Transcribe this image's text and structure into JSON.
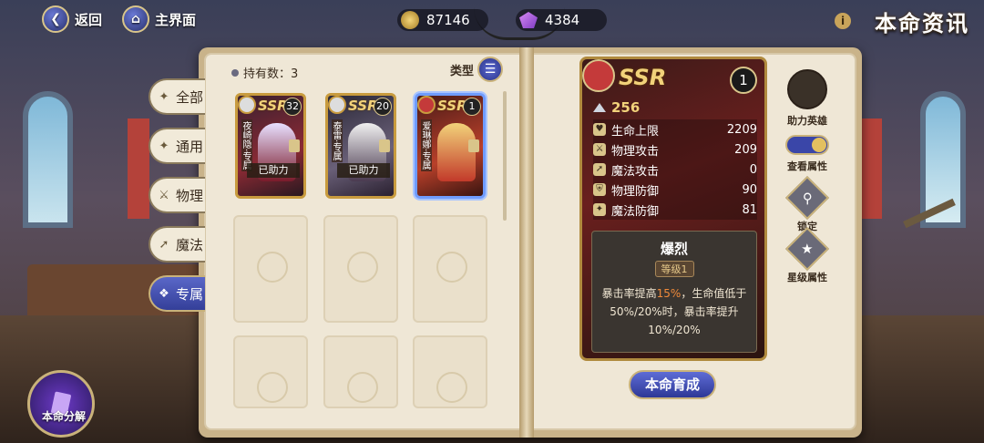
{
  "top": {
    "back_label": "返回",
    "home_label": "主界面",
    "gold": "87146",
    "gems": "4384",
    "title": "本命资讯"
  },
  "tabs": [
    {
      "label": "全部",
      "icon": "star-icon"
    },
    {
      "label": "通用",
      "icon": "star-icon"
    },
    {
      "label": "物理",
      "icon": "sword-icon"
    },
    {
      "label": "魔法",
      "icon": "wand-icon"
    },
    {
      "label": "专属",
      "icon": "crest-icon",
      "active": true
    }
  ],
  "collection": {
    "count_label": "持有数：3",
    "type_label": "类型",
    "cards": [
      {
        "rarity": "SSR",
        "level": "32",
        "name": "夜崎隐·专属",
        "status": "已助力",
        "accent": "#7a1a2a"
      },
      {
        "rarity": "SSR",
        "level": "20",
        "name": "泰雷·专属",
        "status": "已助力",
        "accent": "#4a3a50"
      },
      {
        "rarity": "SSR",
        "level": "1",
        "name": "爱琳娜·专属",
        "status": "",
        "accent": "#c23a2a"
      }
    ]
  },
  "detail": {
    "rarity": "SSR",
    "level": "1",
    "power": "256",
    "stats": [
      {
        "label": "生命上限",
        "value": "2209",
        "icon": "heart-icon"
      },
      {
        "label": "物理攻击",
        "value": "209",
        "icon": "sword-icon"
      },
      {
        "label": "魔法攻击",
        "value": "0",
        "icon": "wand-icon"
      },
      {
        "label": "物理防御",
        "value": "90",
        "icon": "shield-icon"
      },
      {
        "label": "魔法防御",
        "value": "81",
        "icon": "magic-shield-icon"
      }
    ],
    "skill": {
      "title": "爆烈",
      "level": "等级1",
      "desc_pre": "暴击率提高",
      "desc_highlight": "15%",
      "desc_post": "，生命值低于50%/20%时，暴击率提升10%/20%"
    },
    "cultivate_label": "本命育成"
  },
  "side": {
    "assist_label": "助力英雄",
    "view_attr_label": "查看属性",
    "lock_label": "锁定",
    "star_attr_label": "星级属性"
  },
  "decompose_label": "本命分解"
}
